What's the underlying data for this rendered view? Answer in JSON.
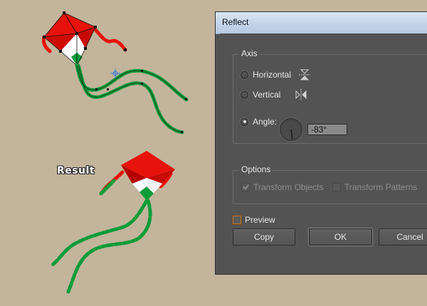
{
  "canvas": {
    "result_label": "Result",
    "colors": {
      "background": "#c2b59b",
      "kite_red": "#e8120c",
      "kite_dark_red": "#b50000",
      "kite_white": "#ffffff",
      "tail_green": "#0e9c3a"
    }
  },
  "dialog": {
    "title": "Reflect",
    "axis": {
      "legend": "Axis",
      "horizontal_label": "Horizontal",
      "vertical_label": "Vertical",
      "angle_label": "Angle:",
      "angle_value": "-83°",
      "selected": "angle",
      "horizontal_icon": "reflect-horizontal-icon",
      "vertical_icon": "reflect-vertical-icon",
      "angle_dial_icon": "angle-dial-icon"
    },
    "options": {
      "legend": "Options",
      "transform_objects_label": "Transform Objects",
      "transform_objects_checked": true,
      "transform_patterns_label": "Transform Patterns",
      "transform_patterns_checked": false
    },
    "preview_label": "Preview",
    "preview_checked": false,
    "buttons": {
      "copy": "Copy",
      "ok": "OK",
      "cancel": "Cancel"
    }
  }
}
